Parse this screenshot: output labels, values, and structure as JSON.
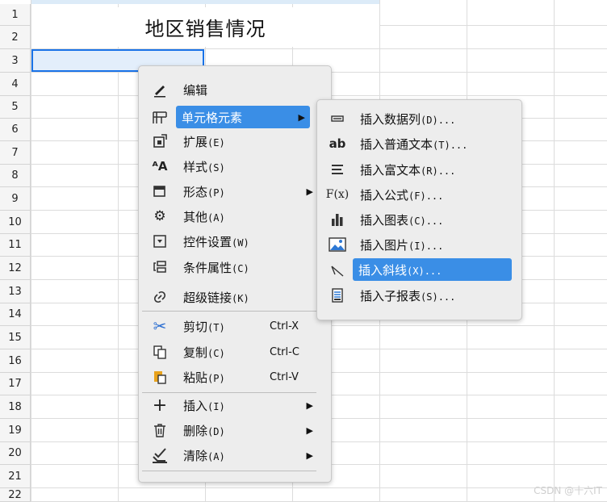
{
  "sheet": {
    "title": "地区销售情况",
    "rows": [
      "1",
      "2",
      "3",
      "4",
      "5",
      "6",
      "7",
      "8",
      "9",
      "10",
      "11",
      "12",
      "13",
      "14",
      "15",
      "16",
      "17",
      "18",
      "19",
      "20",
      "21",
      "22"
    ]
  },
  "context_menu": {
    "items": [
      {
        "label": "编辑",
        "key": "",
        "shortcut": "",
        "icon": "pencil-icon",
        "submenu": false
      },
      {
        "label": "单元格元素",
        "key": "",
        "shortcut": "",
        "icon": "cell-element-icon",
        "submenu": true,
        "highlighted": true
      },
      {
        "label": "扩展",
        "key": "(E)",
        "shortcut": "",
        "icon": "expand-icon",
        "submenu": false
      },
      {
        "label": "样式",
        "key": "(S)",
        "shortcut": "",
        "icon": "style-icon",
        "submenu": false
      },
      {
        "label": "形态",
        "key": "(P)",
        "shortcut": "",
        "icon": "shape-icon",
        "submenu": true
      },
      {
        "label": "其他",
        "key": "(A)",
        "shortcut": "",
        "icon": "gear-icon",
        "submenu": false
      },
      {
        "label": "控件设置",
        "key": "(W)",
        "shortcut": "",
        "icon": "widget-icon",
        "submenu": false
      },
      {
        "label": "条件属性",
        "key": "(C)",
        "shortcut": "",
        "icon": "condition-icon",
        "submenu": false
      },
      {
        "label": "超级链接",
        "key": "(K)",
        "shortcut": "",
        "icon": "link-icon",
        "submenu": false
      },
      {
        "label": "剪切",
        "key": "(T)",
        "shortcut": "Ctrl-X",
        "icon": "scissors-icon",
        "submenu": false
      },
      {
        "label": "复制",
        "key": "(C)",
        "shortcut": "Ctrl-C",
        "icon": "copy-icon",
        "submenu": false
      },
      {
        "label": "粘贴",
        "key": "(P)",
        "shortcut": "Ctrl-V",
        "icon": "paste-icon",
        "submenu": false
      },
      {
        "label": "插入",
        "key": "(I)",
        "shortcut": "",
        "icon": "plus-icon",
        "submenu": true
      },
      {
        "label": "删除",
        "key": "(D)",
        "shortcut": "",
        "icon": "trash-icon",
        "submenu": true
      },
      {
        "label": "清除",
        "key": "(A)",
        "shortcut": "",
        "icon": "eraser-icon",
        "submenu": true
      }
    ]
  },
  "submenu": {
    "items": [
      {
        "label": "插入数据列",
        "key": "(D)...",
        "icon": "data-column-icon"
      },
      {
        "label": "插入普通文本",
        "key": "(T)...",
        "icon": "text-ab-icon"
      },
      {
        "label": "插入富文本",
        "key": "(R)...",
        "icon": "rich-text-icon"
      },
      {
        "label": "插入公式",
        "key": "(F)...",
        "icon": "formula-icon"
      },
      {
        "label": "插入图表",
        "key": "(C)...",
        "icon": "chart-icon"
      },
      {
        "label": "插入图片",
        "key": "(I)...",
        "icon": "image-icon"
      },
      {
        "label": "插入斜线",
        "key": "(X)...",
        "icon": "diagonal-line-icon",
        "highlighted": true
      },
      {
        "label": "插入子报表",
        "key": "(S)...",
        "icon": "subreport-icon"
      }
    ]
  },
  "icons": {
    "text_ab": "ab",
    "formula": "F(x)"
  },
  "watermark": "CSDN @十六IT",
  "colors": {
    "highlight": "#3a8ee6",
    "selection_border": "#1a73e8",
    "selection_fill": "#e3eefb"
  }
}
